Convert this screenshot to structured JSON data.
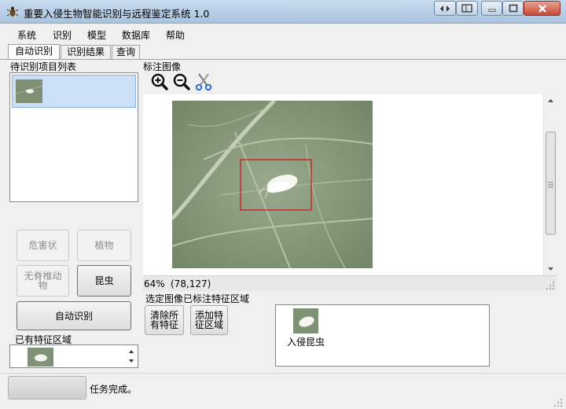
{
  "window": {
    "title": "重要入侵生物智能识别与远程鉴定系统 1.0",
    "app_icon": "beetle-icon"
  },
  "menu": [
    "系统",
    "识别",
    "模型",
    "数据库",
    "帮助"
  ],
  "tabs": [
    "自动识别",
    "识别结果",
    "查询"
  ],
  "left": {
    "pending_label": "待识别项目列表",
    "category_buttons": {
      "harm": "危害状",
      "plant": "植物",
      "invertebrate": "无脊椎动物",
      "insect": "昆虫"
    },
    "auto_identify": "自动识别",
    "existing_label": "已有特征区域"
  },
  "right": {
    "image_label": "标注图像",
    "toolbar_icons": [
      "zoom-in-icon",
      "zoom-out-icon",
      "scissors-icon"
    ],
    "zoom_percent": "64%",
    "coords": "(78,127)",
    "feature_label": "选定图像已标注特征区域",
    "clear_all": "清除所有特征",
    "add_region": "添加特征区域",
    "feature_item": "入侵昆虫"
  },
  "status": {
    "message": "任务完成。"
  },
  "colors": {
    "selection": "#cce0f7",
    "annotation_box": "#d11a1a"
  }
}
